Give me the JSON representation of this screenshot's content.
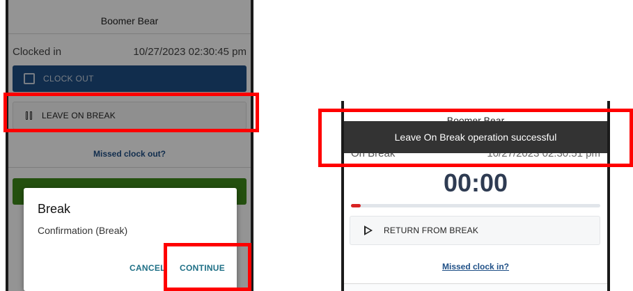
{
  "left_screen": {
    "user_name": "Boomer Bear",
    "status_label": "Clocked in",
    "status_time": "10/27/2023 02:30:45 pm",
    "clock_out_label": "CLOCK OUT",
    "leave_on_break_label": "LEAVE ON BREAK",
    "missed_link": "Missed clock out?",
    "dialog": {
      "title": "Break",
      "message": "Confirmation (Break)",
      "cancel_label": "CANCEL",
      "continue_label": "CONTINUE"
    }
  },
  "right_screen": {
    "user_name": "Boomer Bear",
    "status_label": "On Break",
    "status_time": "10/27/2023 02:30:51 pm",
    "toast": "Leave On Break operation successful",
    "timer": "00:00",
    "progress": 0.01,
    "return_label": "RETURN FROM BREAK",
    "missed_link": "Missed clock in?"
  },
  "colors": {
    "highlight": "#ff0000",
    "primary": "#1e4f86",
    "success": "#3f8a1b",
    "toast_bg": "#333333",
    "progress_fill": "#d82222"
  }
}
